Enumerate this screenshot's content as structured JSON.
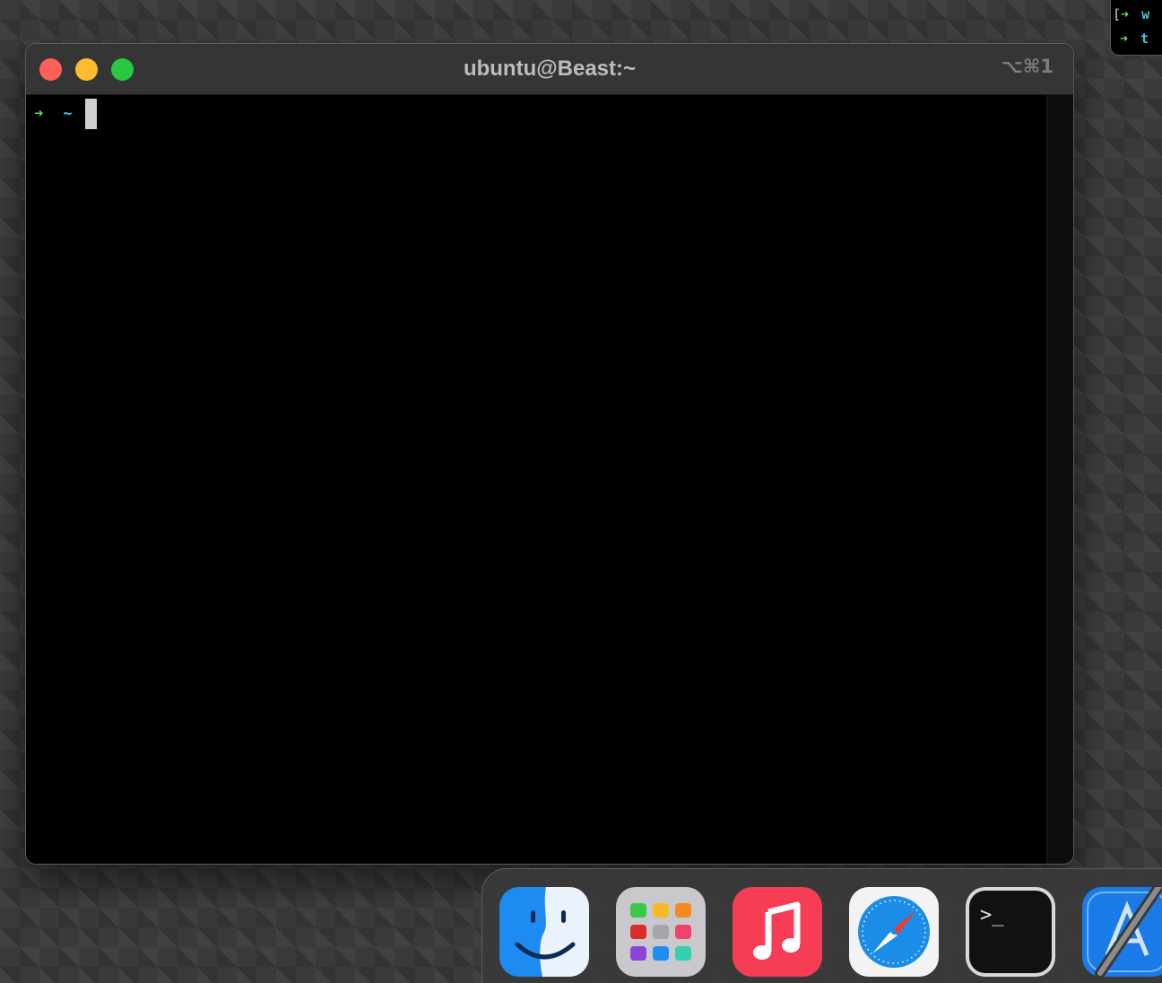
{
  "background_terminal": {
    "lines": [
      {
        "bracket": "[",
        "arrow": "➜",
        "text": "w"
      },
      {
        "bracket": "",
        "arrow": "➜",
        "text": "t"
      }
    ]
  },
  "window": {
    "title": "ubuntu@Beast:~",
    "shortcut": "⌥⌘1"
  },
  "terminal": {
    "prompt_arrow": "➜",
    "cwd": "~",
    "input": ""
  },
  "dock": {
    "apps": [
      {
        "name": "Finder",
        "icon": "finder-icon"
      },
      {
        "name": "Launchpad",
        "icon": "launchpad-icon"
      },
      {
        "name": "Music",
        "icon": "music-icon"
      },
      {
        "name": "Safari",
        "icon": "safari-icon"
      },
      {
        "name": "Terminal",
        "icon": "terminal-icon",
        "glyph": ">_"
      },
      {
        "name": "Xcode",
        "icon": "xcode-icon"
      }
    ]
  },
  "colors": {
    "prompt_arrow": "#5fd35f",
    "cwd": "#3fc6d8",
    "close": "#fe5f57",
    "minimize": "#febc2e",
    "zoom": "#28c840"
  }
}
